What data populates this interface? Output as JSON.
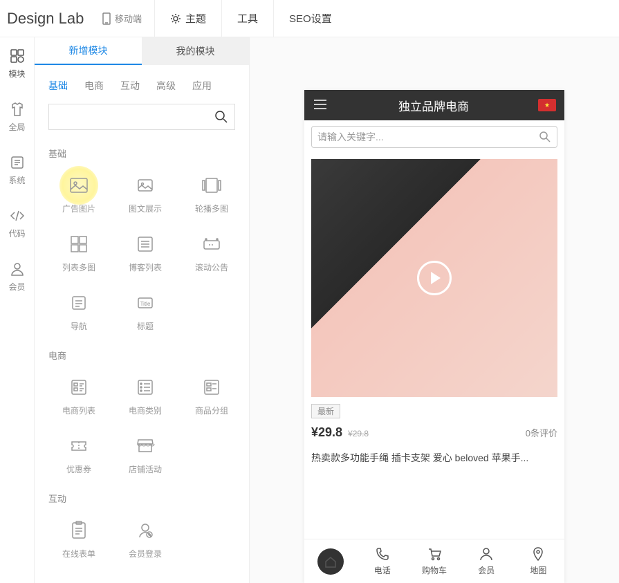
{
  "top": {
    "logo": "Design Lab",
    "device": "移动端",
    "theme": "主题",
    "tools": "工具",
    "seo": "SEO设置"
  },
  "rail": {
    "modules": "模块",
    "global": "全局",
    "system": "系统",
    "code": "代码",
    "member": "会员"
  },
  "panel": {
    "tab_new": "新增模块",
    "tab_my": "我的模块",
    "subtabs": {
      "basic": "基础",
      "ecom": "电商",
      "interact": "互动",
      "advanced": "高级",
      "app": "应用"
    },
    "search_placeholder": "",
    "sections": {
      "basic": "基础",
      "ecom": "电商",
      "interact": "互动"
    },
    "mods": {
      "ad_image": "广告图片",
      "image_text": "图文展示",
      "carousel": "轮播多图",
      "list_image": "列表多图",
      "blog_list": "博客列表",
      "scroll_notice": "滚动公告",
      "nav": "导航",
      "title": "标题",
      "title_inner": "Title",
      "ecom_list": "电商列表",
      "ecom_cat": "电商类别",
      "product_group": "商品分组",
      "coupon": "优惠券",
      "shop_activity": "店铺活动",
      "online_form": "在线表单",
      "member_login": "会员登录"
    }
  },
  "preview": {
    "header_title": "独立品牌电商",
    "search_placeholder": "请输入关键字...",
    "badge": "最新",
    "price": "¥29.8",
    "price_old": "¥29.8",
    "reviews": "0条评价",
    "product_title": "热卖款多功能手绳 插卡支架 爱心 beloved 苹果手...",
    "nav": {
      "phone": "电话",
      "cart": "购物车",
      "member": "会员",
      "map": "地图"
    }
  }
}
